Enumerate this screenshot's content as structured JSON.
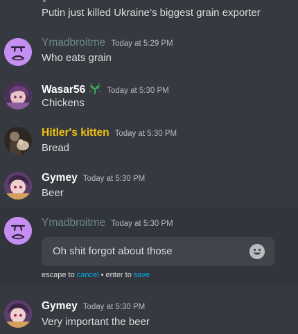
{
  "top_message": {
    "text": "Putin just killed Ukraine’s biggest grain exporter"
  },
  "messages": [
    {
      "username": "Ymadbroitme",
      "timestamp": "Today at 5:29 PM",
      "text": "Who eats grain",
      "avatar": "purple-face-avatar"
    },
    {
      "username": "Wasar56",
      "timestamp": "Today at 5:30 PM",
      "text": "Chickens",
      "avatar": "anime-avatar",
      "badge": "sprout-badge-icon"
    },
    {
      "username": "Hitler's kitten",
      "timestamp": "Today at 5:30 PM",
      "text": "Bread",
      "avatar": "photo-avatar"
    },
    {
      "username": "Gymey",
      "timestamp": "Today at 5:30 PM",
      "text": "Beer",
      "avatar": "anime-avatar"
    },
    {
      "username": "Ymadbroitme",
      "timestamp": "Today at 5:30 PM",
      "avatar": "purple-face-avatar"
    },
    {
      "username": "Gymey",
      "timestamp": "Today at 5:30 PM",
      "text": "Very important the beer",
      "avatar": "anime-avatar"
    }
  ],
  "edit": {
    "value": "Oh shit forgot about those",
    "hint_escape": "escape to ",
    "hint_cancel": "cancel",
    "hint_sep": " • enter to ",
    "hint_save": "save"
  },
  "colors": {
    "background": "#36393f",
    "edit_highlight": "#32353b",
    "input_bg": "#40444b",
    "link": "#00aff4",
    "role_gold": "#f1c40f",
    "muted_name": "#6e8a8a",
    "badge_green": "#3ba55c"
  }
}
